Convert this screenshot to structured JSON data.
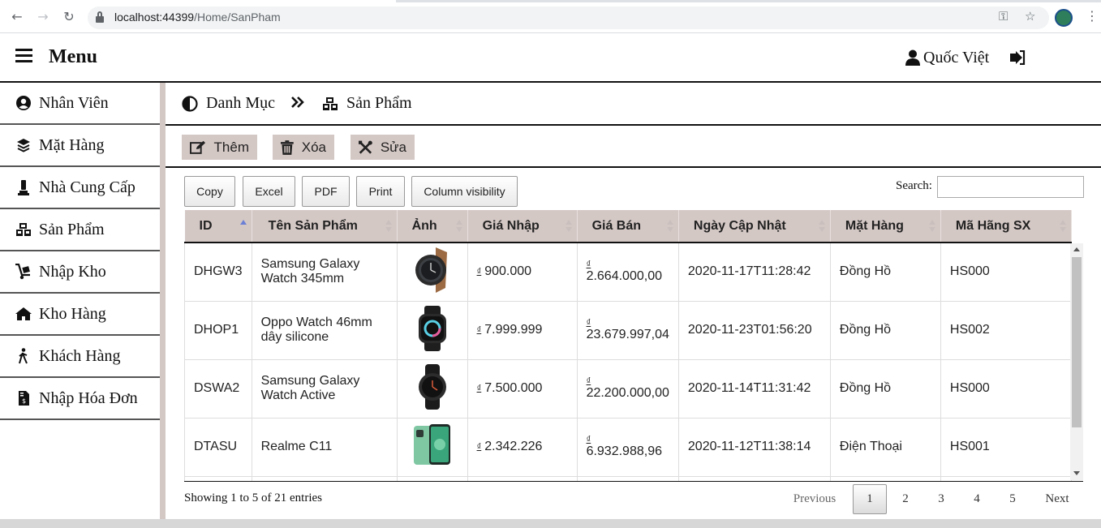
{
  "browser": {
    "url_host": "localhost:44399",
    "url_path": "/Home/SanPham"
  },
  "header": {
    "menu_label": "Menu",
    "user_name": "Quốc Việt"
  },
  "sidebar": {
    "items": [
      {
        "label": "Nhân Viên",
        "icon": "user-circle-icon"
      },
      {
        "label": "Mặt Hàng",
        "icon": "layers-icon"
      },
      {
        "label": "Nhà Cung Cấp",
        "icon": "chess-piece-icon"
      },
      {
        "label": "Sản Phẩm",
        "icon": "cubes-icon"
      },
      {
        "label": "Nhập Kho",
        "icon": "dolly-icon"
      },
      {
        "label": "Kho Hàng",
        "icon": "home-icon"
      },
      {
        "label": "Khách Hàng",
        "icon": "walking-person-icon"
      },
      {
        "label": "Nhập Hóa Đơn",
        "icon": "invoice-icon"
      }
    ]
  },
  "breadcrumb": {
    "parent": "Danh Mục",
    "current": "Sản Phẩm"
  },
  "actions": {
    "add": "Thêm",
    "delete": "Xóa",
    "edit": "Sửa"
  },
  "datatable": {
    "buttons": [
      "Copy",
      "Excel",
      "PDF",
      "Print",
      "Column visibility"
    ],
    "search_label": "Search:",
    "search_value": "",
    "columns": [
      "ID",
      "Tên Sản Phẩm",
      "Ảnh",
      "Giá Nhập",
      "Giá Bán",
      "Ngày Cập Nhật",
      "Mặt Hàng",
      "Mã Hãng SX"
    ],
    "currency_symbol": "₫",
    "rows": [
      {
        "id": "DHGW3",
        "name": "Samsung Galaxy Watch 345mm",
        "image": "brown-strap-watch",
        "gia_nhap": "900.000",
        "gia_ban": "2.664.000,00",
        "ngay": "2020-11-17T11:28:42",
        "mat_hang": "Đồng Hồ",
        "hang": "HS000"
      },
      {
        "id": "DHOP1",
        "name": "Oppo Watch 46mm dây silicone",
        "image": "square-smartwatch",
        "gia_nhap": "7.999.999",
        "gia_ban": "23.679.997,04",
        "ngay": "2020-11-23T01:56:20",
        "mat_hang": "Đồng Hồ",
        "hang": "HS002"
      },
      {
        "id": "DSWA2",
        "name": "Samsung Galaxy Watch Active",
        "image": "black-round-watch",
        "gia_nhap": "7.500.000",
        "gia_ban": "22.200.000,00",
        "ngay": "2020-11-14T11:31:42",
        "mat_hang": "Đồng Hồ",
        "hang": "HS000"
      },
      {
        "id": "DTASU",
        "name": "Realme C11",
        "image": "green-phone",
        "gia_nhap": "2.342.226",
        "gia_ban": "6.932.988,96",
        "ngay": "2020-11-12T11:38:14",
        "mat_hang": "Điện Thoại",
        "hang": "HS001"
      }
    ],
    "info": "Showing 1 to 5 of 21 entries",
    "pagination": {
      "previous": "Previous",
      "pages": [
        "1",
        "2",
        "3",
        "4",
        "5"
      ],
      "current": "1",
      "next": "Next"
    }
  },
  "colors": {
    "accent": "#d4c8c5",
    "sort_active": "#6b7fd4"
  }
}
